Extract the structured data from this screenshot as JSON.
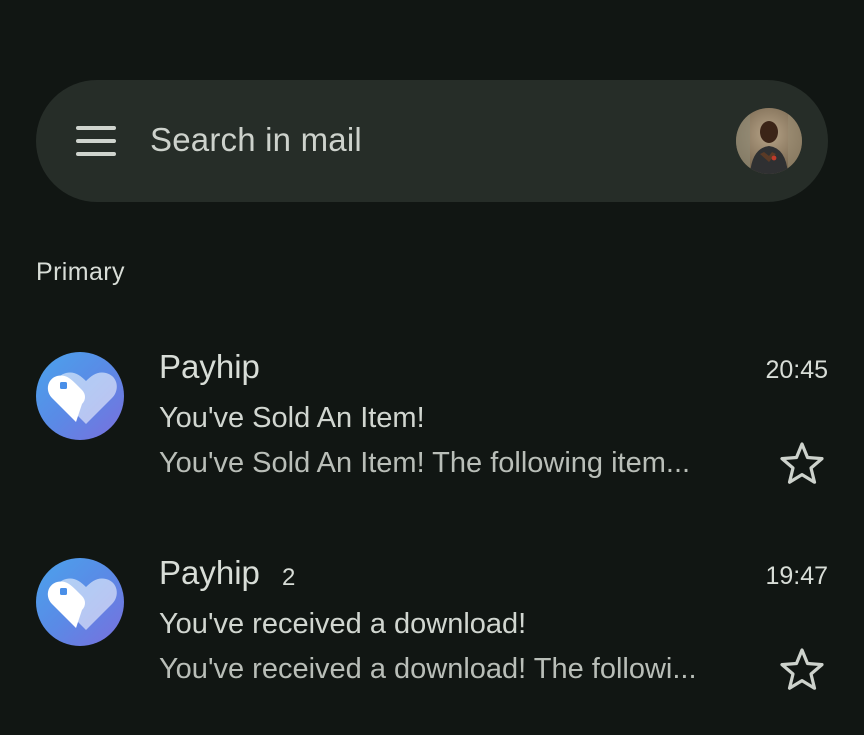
{
  "search": {
    "placeholder": "Search in mail",
    "menu_icon": "hamburger-menu-icon",
    "avatar": "account-avatar"
  },
  "section": {
    "label": "Primary"
  },
  "mails": [
    {
      "sender": "Payhip",
      "count": "",
      "time": "20:45",
      "subject": "You've Sold An Item!",
      "snippet": "You've Sold An Item! The following item...",
      "starred": false,
      "avatar_icon": "heart-tag-icon",
      "avatar_gradient": [
        "#4aa3ec",
        "#7a6fdd"
      ]
    },
    {
      "sender": "Payhip",
      "count": "2",
      "time": "19:47",
      "subject": "You've received a download!",
      "snippet": "You've received a download! The followi...",
      "starred": false,
      "avatar_icon": "heart-tag-icon",
      "avatar_gradient": [
        "#4aa3ec",
        "#7a6fdd"
      ]
    }
  ],
  "colors": {
    "background": "#111613",
    "searchbar": "#262d28",
    "text": "#d8ddd7"
  }
}
